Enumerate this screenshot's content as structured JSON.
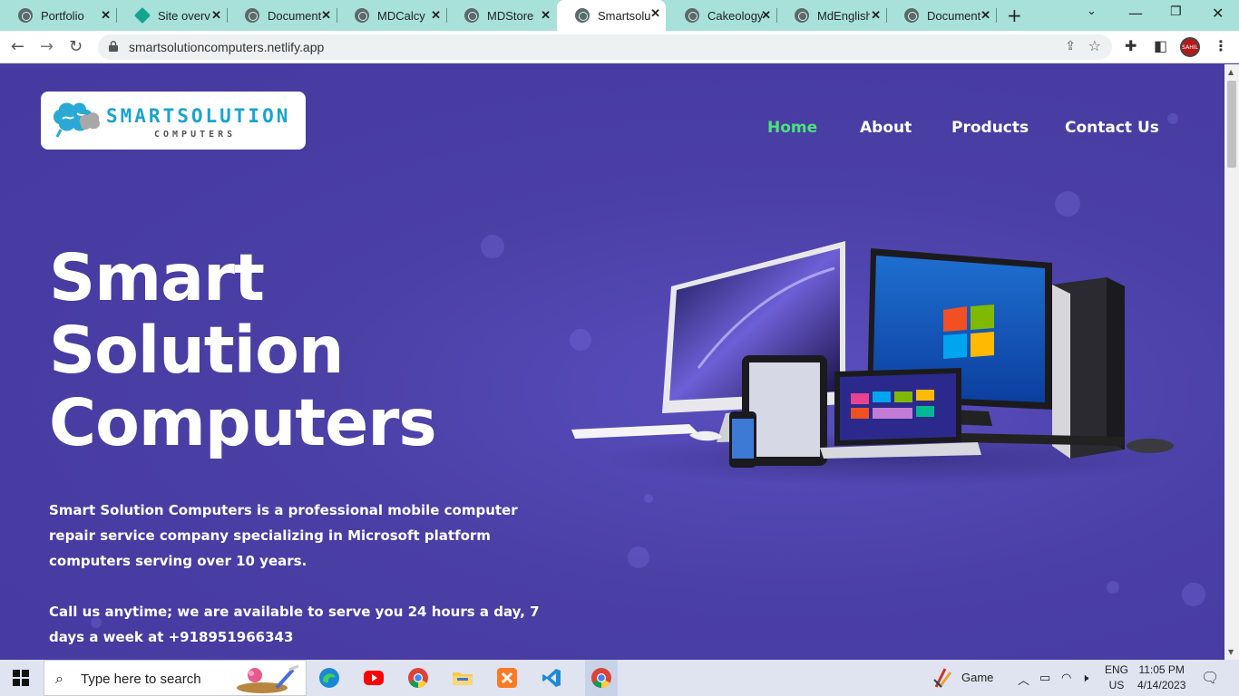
{
  "browser": {
    "tabs": [
      {
        "label": "Portfolio",
        "icon": "globe-icon",
        "active": false
      },
      {
        "label": "Site overvi",
        "icon": "netlify-icon",
        "active": false
      },
      {
        "label": "Document",
        "icon": "globe-icon",
        "active": false
      },
      {
        "label": "MDCalcy",
        "icon": "globe-icon",
        "active": false
      },
      {
        "label": "MDStore",
        "icon": "globe-icon",
        "active": false
      },
      {
        "label": "Smartsolut",
        "icon": "globe-icon",
        "active": true
      },
      {
        "label": "Cakeology",
        "icon": "globe-icon",
        "active": false
      },
      {
        "label": "MdEnglish",
        "icon": "globe-icon",
        "active": false
      },
      {
        "label": "Document",
        "icon": "globe-icon",
        "active": false
      }
    ],
    "url": "smartsolutioncomputers.netlify.app",
    "profile_label": "SAHIL"
  },
  "site": {
    "logo": {
      "title": "SMARTSOLUTION",
      "subtitle": "COMPUTERS"
    },
    "nav": [
      {
        "label": "Home",
        "active": true
      },
      {
        "label": "About",
        "active": false
      },
      {
        "label": "Products",
        "active": false
      },
      {
        "label": "Contact Us",
        "active": false
      }
    ],
    "hero": {
      "title_lines": [
        "Smart",
        "Solution",
        "Computers"
      ],
      "paragraph1": "Smart Solution Computers is a professional mobile computer repair service company specializing in Microsoft platform computers serving over 10 years.",
      "paragraph2": "Call us anytime; we are available to serve you 24 hours a day, 7 days a week at +918951966343"
    },
    "colors": {
      "background": "#4b3fa3",
      "nav_active": "#4be37c",
      "logo_text": "#1ba3cf"
    }
  },
  "taskbar": {
    "search_placeholder": "Type here to search",
    "weather_label": "Game",
    "lang_top": "ENG",
    "lang_bottom": "US",
    "time": "11:05 PM",
    "date": "4/14/2023"
  }
}
